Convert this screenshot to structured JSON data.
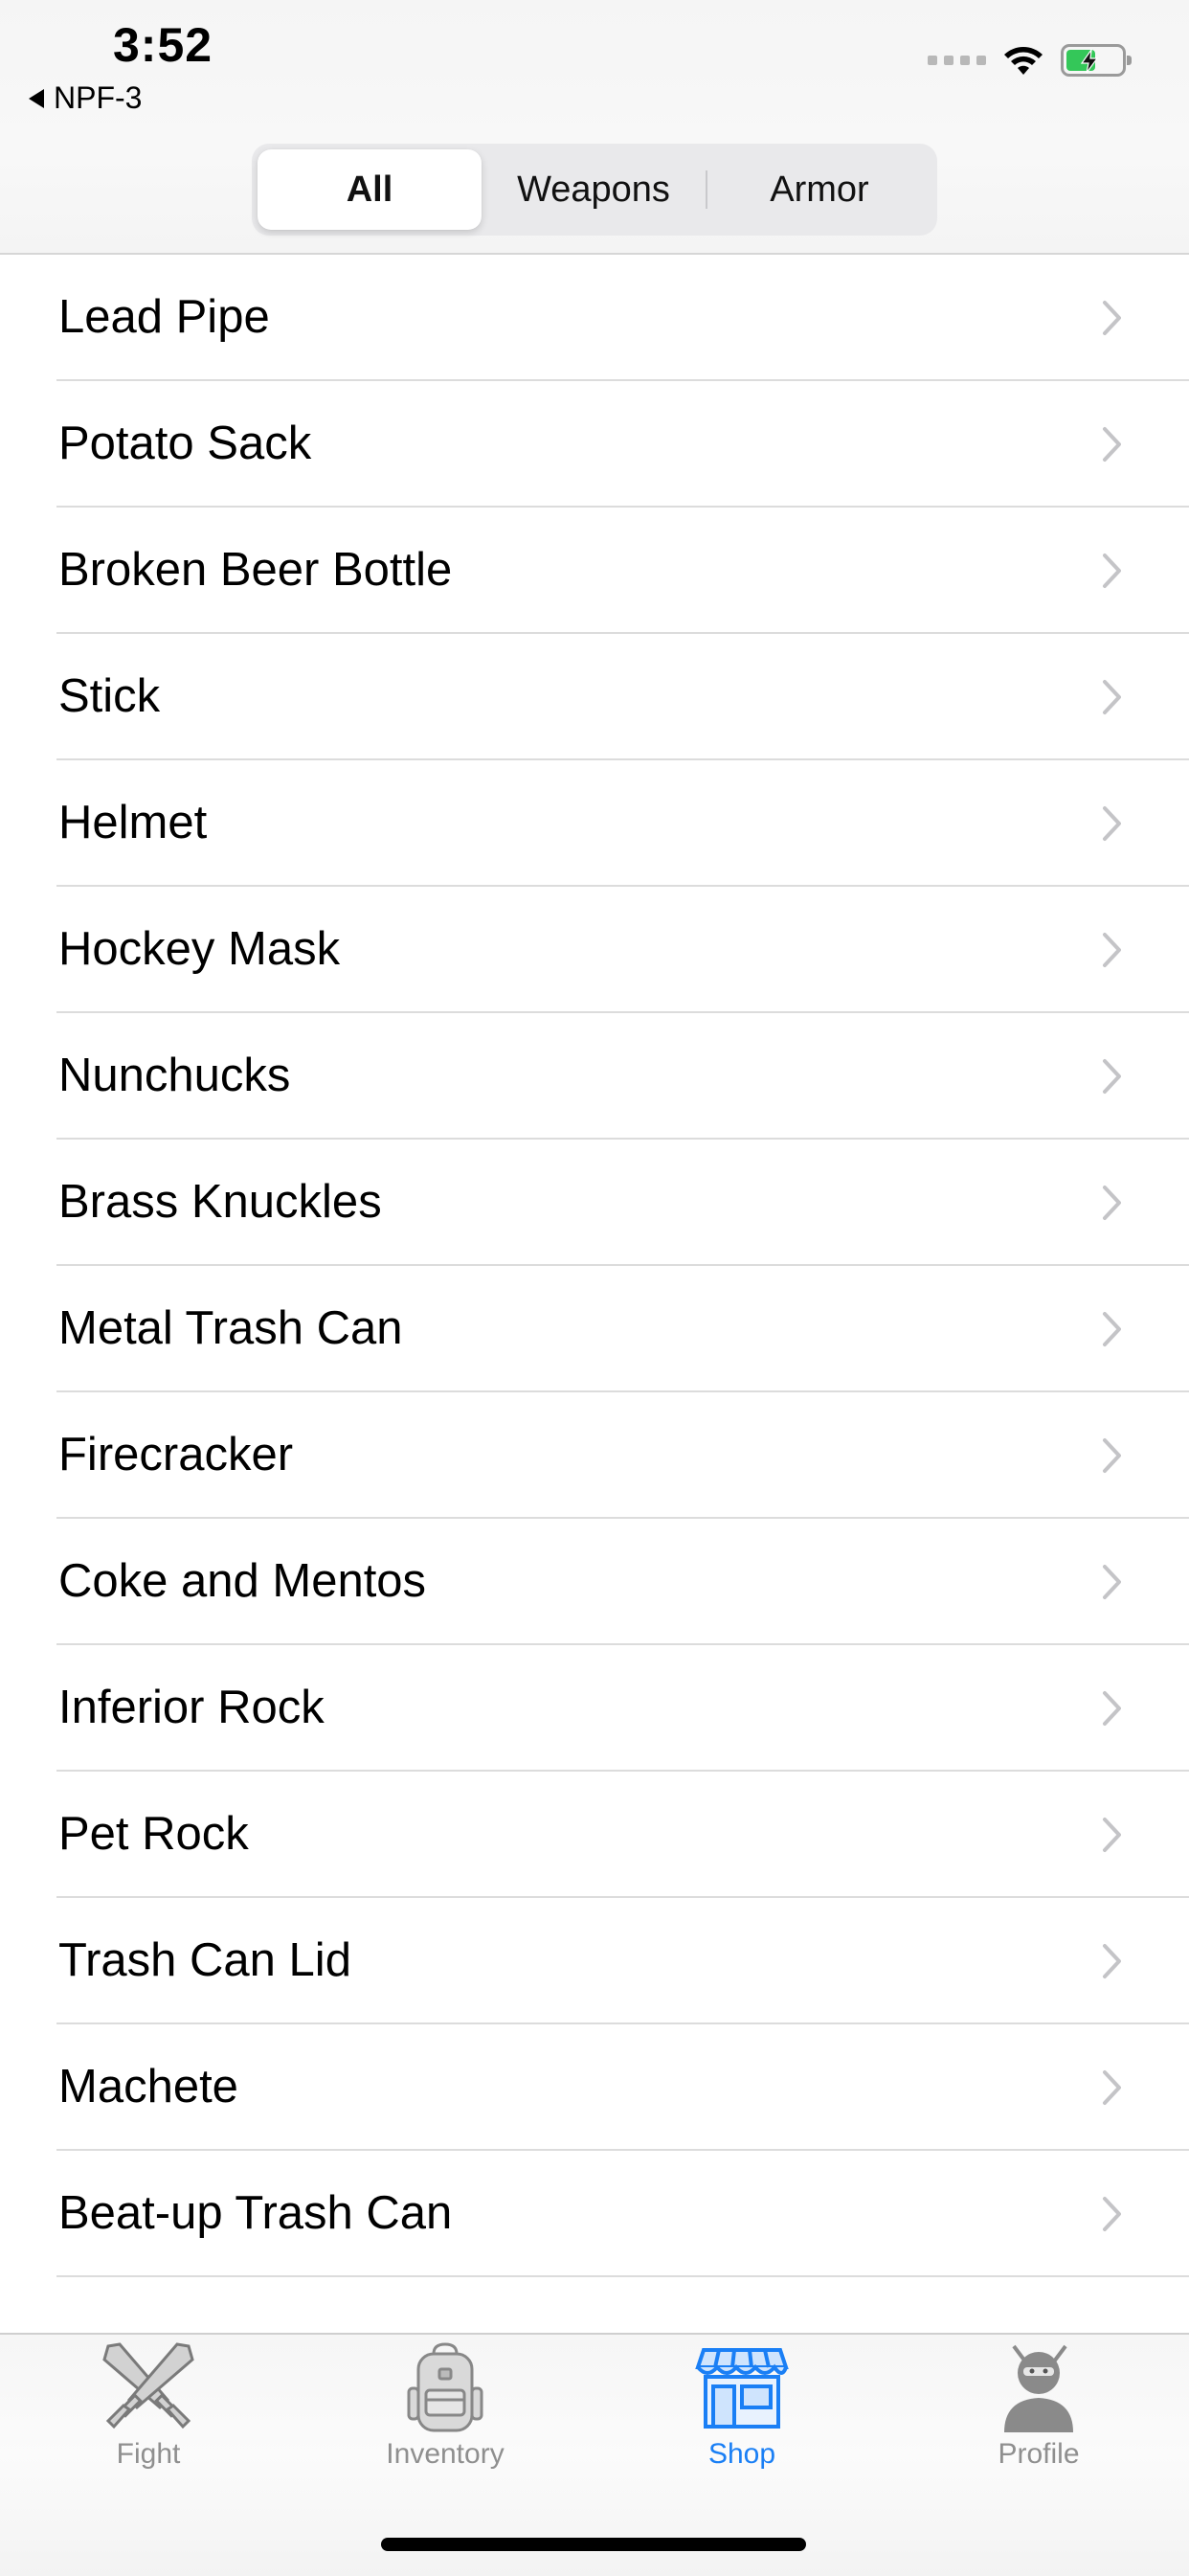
{
  "status_bar": {
    "time": "3:52",
    "back_app": "NPF-3",
    "icons": [
      "cellular-dots-icon",
      "wifi-icon",
      "battery-charging-icon"
    ]
  },
  "segments": {
    "all": "All",
    "weapons": "Weapons",
    "armor": "Armor",
    "selected": "All"
  },
  "items": [
    "Lead Pipe",
    "Potato Sack",
    "Broken Beer Bottle",
    "Stick",
    "Helmet",
    "Hockey Mask",
    "Nunchucks",
    "Brass Knuckles",
    "Metal Trash Can",
    "Firecracker",
    "Coke and Mentos",
    "Inferior Rock",
    "Pet Rock",
    "Trash Can Lid",
    "Machete",
    "Beat-up Trash Can"
  ],
  "tabbar": {
    "fight": "Fight",
    "inventory": "Inventory",
    "shop": "Shop",
    "profile": "Profile",
    "selected": "Shop"
  },
  "colors": {
    "accent": "#1a7ff5",
    "battery_fill": "#34c759",
    "inactive_tab": "#8f8f8f"
  }
}
